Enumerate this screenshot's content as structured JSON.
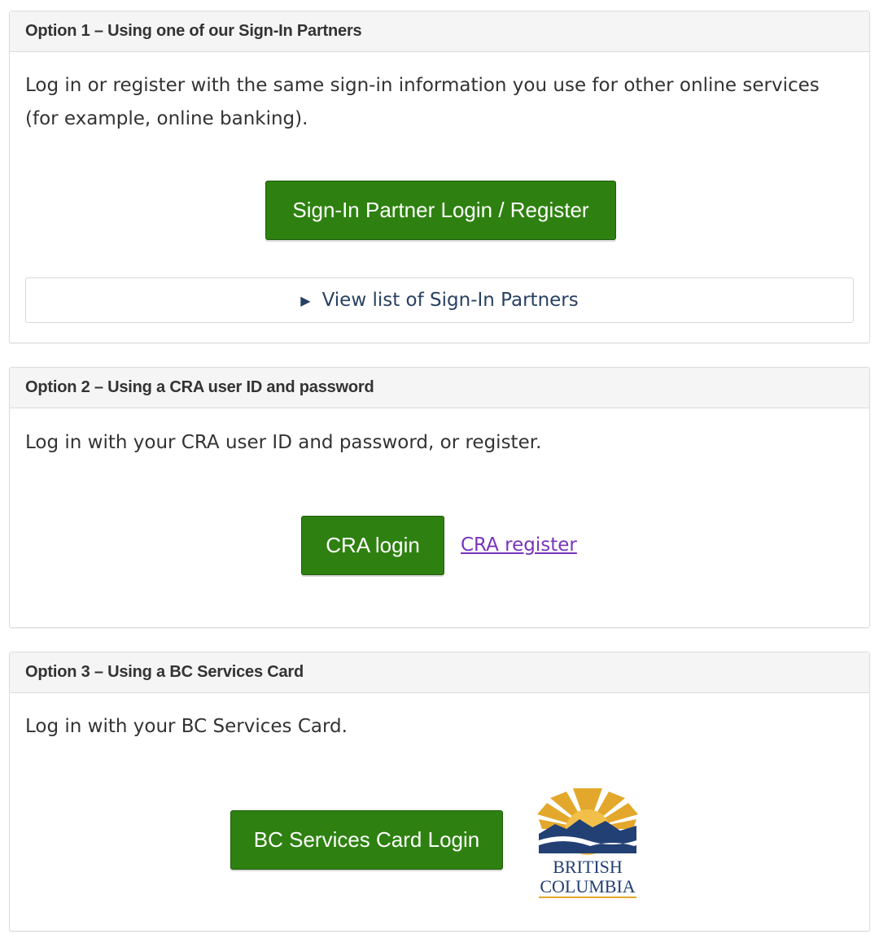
{
  "option1": {
    "heading": "Option 1 – Using one of our Sign-In Partners",
    "description": "Log in or register with the same sign-in information you use for other online services (for example, online banking).",
    "button_label": "Sign-In Partner Login / Register",
    "details_label": "View list of Sign-In Partners"
  },
  "option2": {
    "heading": "Option 2 – Using a CRA user ID and password",
    "description": "Log in with your CRA user ID and password, or register.",
    "button_label": "CRA login",
    "register_link": "CRA register"
  },
  "option3": {
    "heading": "Option 3 – Using a BC Services Card",
    "description": "Log in with your BC Services Card.",
    "button_label": "BC Services Card Login",
    "logo": {
      "icon": "british-columbia-logo",
      "line1": "BRITISH",
      "line2": "COLUMBIA"
    }
  },
  "colors": {
    "button_green": "#2e8110",
    "link_purple": "#7834bc",
    "details_text": "#284162",
    "heading_bg": "#f5f5f5",
    "bc_blue": "#234075",
    "bc_gold": "#e3a82b"
  }
}
